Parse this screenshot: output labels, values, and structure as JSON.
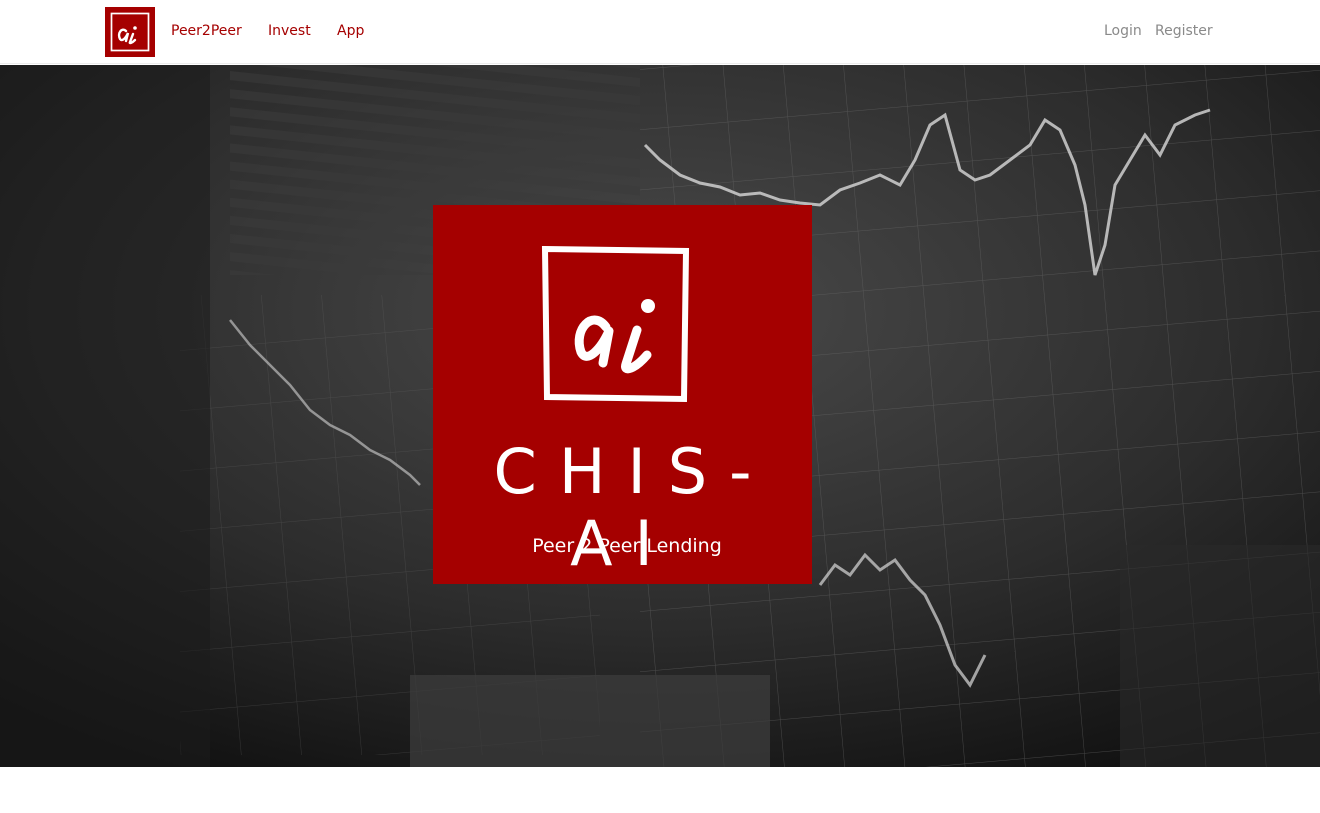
{
  "nav": {
    "logo_text": "ai",
    "links": [
      "Peer2Peer",
      "Invest",
      "App"
    ],
    "login": "Login",
    "register": "Register"
  },
  "hero": {
    "brand_mark_text": "ai",
    "title": "CHIS-AI",
    "subtitle": "Peer 2 Peer Lending",
    "background_icon": "stock-chart-screen-photo"
  },
  "colors": {
    "brand_red": "#a50000",
    "nav_auth_gray": "#8a8a8a",
    "white": "#ffffff"
  }
}
